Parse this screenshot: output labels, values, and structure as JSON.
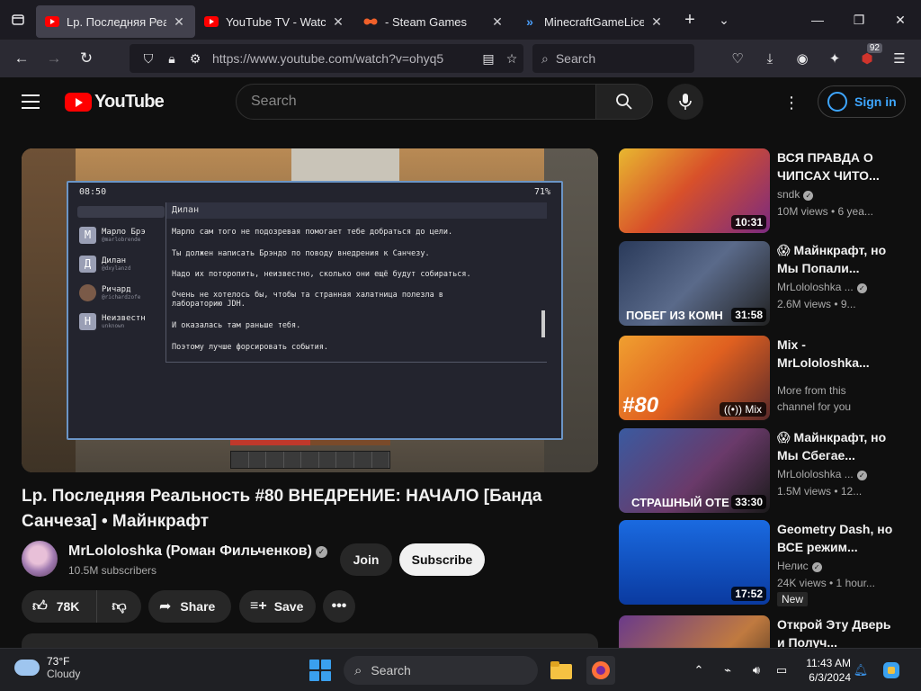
{
  "browser": {
    "tabs": [
      {
        "title": "Lp. Последняя Реальность",
        "favicon": "youtube-icon",
        "active": true
      },
      {
        "title": "YouTube TV - Watch & Stream",
        "favicon": "youtube-icon",
        "active": false
      },
      {
        "title": "- Steam Games",
        "favicon": "steam-icon",
        "active": false
      },
      {
        "title": "MinecraftGameLicense",
        "favicon": "chevrons-icon",
        "active": false
      }
    ],
    "url": "https://www.youtube.com/watch?v=ohyq5",
    "search_placeholder": "Search",
    "extensions_badge": "92"
  },
  "youtube": {
    "logo_text": "YouTube",
    "search_placeholder": "Search",
    "sign_in_label": "Sign in"
  },
  "video": {
    "title": "Lp. Последняя Реальность #80 ВНЕДРЕНИЕ: НАЧАЛО [Банда Санчеза] • Майнкрафт",
    "channel": "MrLololoshka (Роман Фильченков)",
    "subscribers": "10.5M subscribers",
    "join_label": "Join",
    "subscribe_label": "Subscribe",
    "likes": "78K",
    "share_label": "Share",
    "save_label": "Save"
  },
  "player": {
    "phone_time": "08:50",
    "phone_battery": "71%",
    "chat_header": "Дилан",
    "contacts": [
      {
        "initial": "М",
        "name": "Марло Брэ",
        "sub": "@marlobrende"
      },
      {
        "initial": "Д",
        "name": "Дилан",
        "sub": "@dxylanzd"
      },
      {
        "initial": "",
        "name": "Ричард",
        "sub": "@richardzofe"
      },
      {
        "initial": "Н",
        "name": "Неизвестн",
        "sub": "unknown"
      }
    ],
    "messages": [
      "Марло сам того не подозревая помогает тебе добраться до цели.",
      "Ты должен написать Брэндо по поводу внедрения к Санчезу.",
      "Надо их поторопить, неизвестно, сколько они ещё будут собираться.",
      "Очень не хотелось бы, чтобы та странная халатница полезла в лабораторию JDH.",
      "И оказалась там раньше тебя.",
      "Поэтому лучше форсировать события."
    ]
  },
  "recommendations": [
    {
      "title": "ВСЯ ПРАВДА О ЧИПСАХ ЧИТО...",
      "channel": "sndk",
      "meta": "10M views • 6 yea...",
      "duration": "10:31",
      "thumb_bg": "#c8402a"
    },
    {
      "title": "😱 Майнкрафт, но Мы Попали...",
      "channel": "MrLololoshka ...",
      "meta": "2.6M views • 9...",
      "duration": "31:58",
      "thumb_text": "ПОБЕГ ИЗ КОМН",
      "thumb_bg": "#3a4a6a"
    },
    {
      "title": "Mix - MrLololoshka...",
      "sub": "More from this channel for you",
      "mix_label": "((•)) Mix",
      "thumb_text": "#80",
      "thumb_bg": "#e0742a"
    },
    {
      "title": "😱 Майнкрафт, но Мы Сбегае...",
      "channel": "MrLololoshka ...",
      "meta": "1.5M views • 12...",
      "duration": "33:30",
      "thumb_text": "СТРАШНЫЙ ОТЕ",
      "thumb_bg": "#4a3a6a"
    },
    {
      "title": "Geometry Dash, но ВСЕ режим...",
      "channel": "Нелис",
      "meta": "24K views • 1 hour...",
      "duration": "17:52",
      "badge": "New",
      "thumb_bg": "#1a5fd0"
    },
    {
      "title": "Открой Эту Дверь и Получ...",
      "thumb_bg": "#a0603a"
    }
  ],
  "taskbar": {
    "temperature": "73°F",
    "weather": "Cloudy",
    "search_placeholder": "Search",
    "time": "11:43 AM",
    "date": "6/3/2024"
  }
}
